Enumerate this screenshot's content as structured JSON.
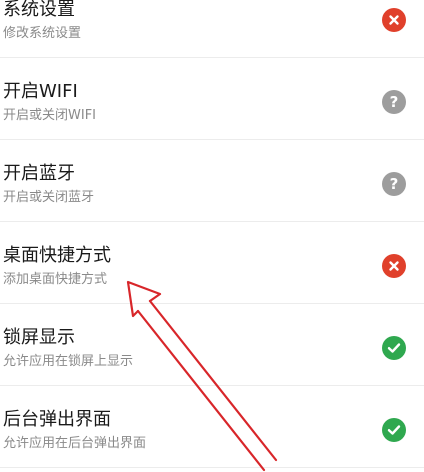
{
  "settings": [
    {
      "title": "系统设置",
      "subtitle": "修改系统设置",
      "status": "denied",
      "icon": "close-icon"
    },
    {
      "title": "开启WIFI",
      "subtitle": "开启或关闭WIFI",
      "status": "unknown",
      "icon": "question-icon"
    },
    {
      "title": "开启蓝牙",
      "subtitle": "开启或关闭蓝牙",
      "status": "unknown",
      "icon": "question-icon"
    },
    {
      "title": "桌面快捷方式",
      "subtitle": "添加桌面快捷方式",
      "status": "denied",
      "icon": "close-icon"
    },
    {
      "title": "锁屏显示",
      "subtitle": "允许应用在锁屏上显示",
      "status": "allowed",
      "icon": "check-icon"
    },
    {
      "title": "后台弹出界面",
      "subtitle": "允许应用在后台弹出界面",
      "status": "allowed",
      "icon": "check-icon"
    }
  ],
  "colors": {
    "denied": "#e0402b",
    "unknown": "#9d9d9d",
    "allowed": "#2fa84f",
    "annotation_arrow": "#d8262a"
  },
  "glyphs": {
    "question": "?"
  }
}
